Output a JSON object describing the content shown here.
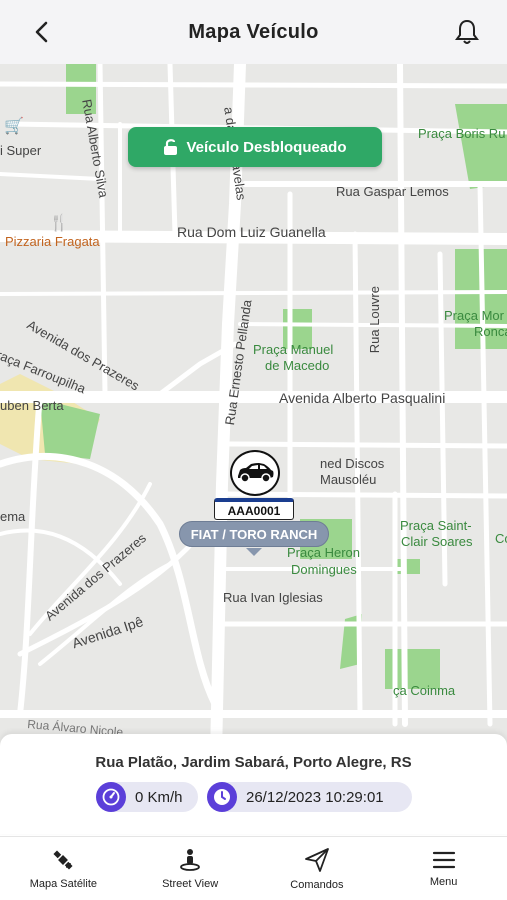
{
  "header": {
    "title": "Mapa Veículo"
  },
  "map": {
    "unlock_status": "Veículo Desbloqueado",
    "labels": {
      "super": "i Super",
      "rua_alberto_silva": "Rua Alberto Silva",
      "das_caravelas": "a das Caravelas",
      "praca_boris": "Praça Boris Ru",
      "rua_gaspar": "Rua Gaspar Lemos",
      "pizzaria": "Pizzaria Fragata",
      "rua_dom_luiz": "Rua Dom Luiz Guanella",
      "praca_morr": "Praça Mor",
      "roncal": "Ronca",
      "av_prazeres_1": "Avenida dos Prazeres",
      "farroupilha": "raça Farroupilha",
      "rua_louvre": "Rua Louvre",
      "praca_manuel": "Praça Manuel",
      "de_macedo": "de Macedo",
      "rua_ernesto": "Rua Ernesto Pellanda",
      "uben_berta": "uben Berta",
      "av_alberto": "Avenida Alberto Pasqualini",
      "discos": "ned Discos",
      "mausoleu": "Mausoléu",
      "ema": "ema",
      "praca_saint": "Praça Saint-",
      "clair": "Clair Soares",
      "co": "Co",
      "av_prazeres_2": "Avenida dos Prazeres",
      "praca_heron": "Praça Heron",
      "domingues": "Domingues",
      "rua_ivan": "Rua Ivan Iglesias",
      "av_ipe": "Avenida Ipê",
      "coinma": "ça Coinma",
      "rua_alvaro": "Rua Álvaro Nicole"
    },
    "vehicle": {
      "plate": "AAA0001",
      "model": "FIAT / TORO RANCH"
    },
    "status_buttons": [
      "key-icon",
      "battery-icon",
      "signal-icon",
      "plug-icon",
      "engine-icon",
      "satellite-icon"
    ]
  },
  "info": {
    "address": "Rua Platão, Jardim Sabará, Porto Alegre, RS",
    "speed": "0 Km/h",
    "datetime": "26/12/2023 10:29:01",
    "accent_color": "#5b3fd9"
  },
  "nav": {
    "satellite": "Mapa Satélite",
    "street_view": "Street View",
    "commands": "Comandos",
    "menu": "Menu"
  },
  "colors": {
    "green": "#2fbf71",
    "header_bg": "#f4f4f6",
    "map_bg": "#e8e8e6"
  }
}
